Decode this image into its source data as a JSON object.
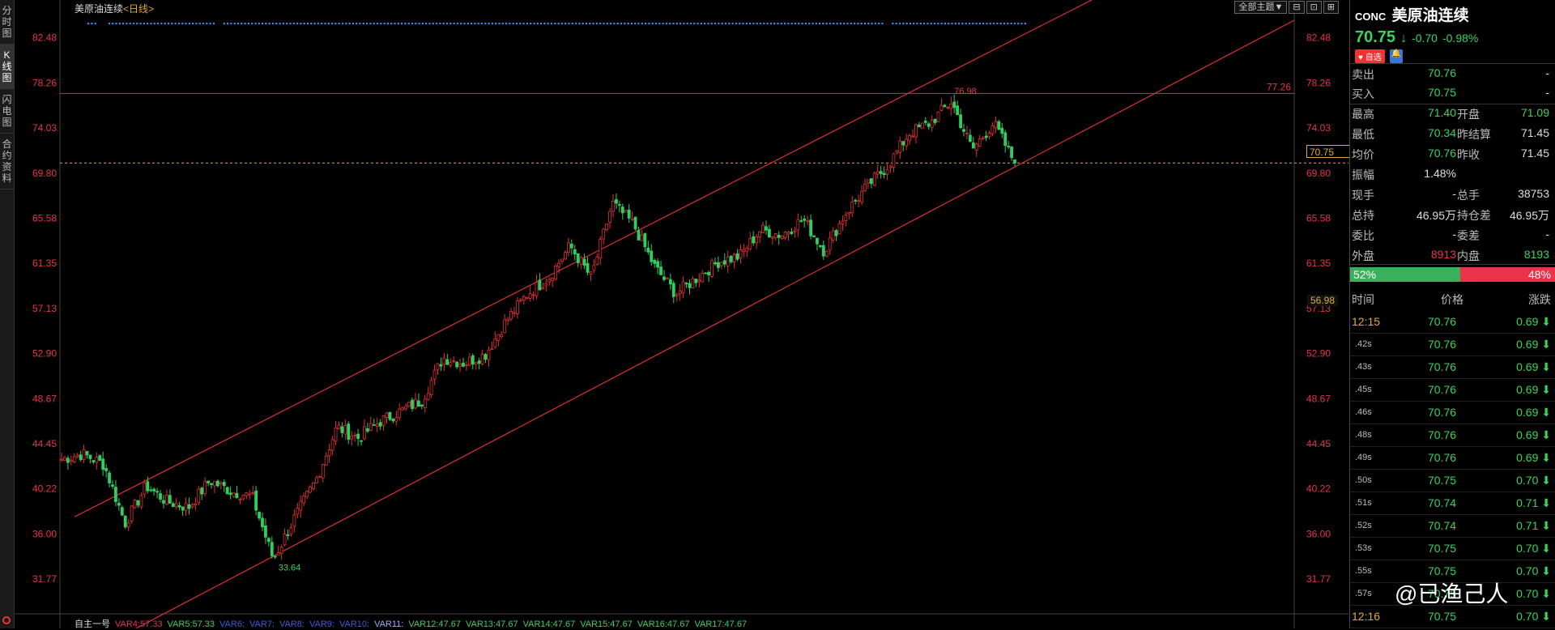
{
  "left_tabs": [
    "分时图",
    "K线图",
    "闪电图",
    "合约资料"
  ],
  "chart": {
    "title": "美原油连续",
    "period": "<日线>",
    "toolbar": [
      "全部主题▼",
      "⊟",
      "⊡",
      "⊞"
    ],
    "y_ticks": [
      "82.48",
      "78.26",
      "74.03",
      "69.80",
      "65.58",
      "61.35",
      "57.13",
      "52.90",
      "48.67",
      "44.45",
      "40.22",
      "36.00",
      "31.77"
    ],
    "resistance_label": "77.26",
    "high_label": "76.98",
    "low_label": "33.64",
    "current_price_label": "70.75",
    "mid_label": "56.98",
    "bottom_indicators": [
      {
        "text": "自主一号",
        "color": "#dddddd"
      },
      {
        "text": "VAR4:57.33",
        "color": "#e9334a"
      },
      {
        "text": "VAR5:57.33",
        "color": "#3bd25b"
      },
      {
        "text": "VAR6:",
        "color": "#3a5fd9"
      },
      {
        "text": "VAR7:",
        "color": "#3a5fd9"
      },
      {
        "text": "VAR8:",
        "color": "#3a5fd9"
      },
      {
        "text": "VAR9:",
        "color": "#3a5fd9"
      },
      {
        "text": "VAR10:",
        "color": "#3a5fd9"
      },
      {
        "text": "VAR11:",
        "color": "#a0a8ff"
      },
      {
        "text": "VAR12:47.67",
        "color": "#3bd25b"
      },
      {
        "text": "VAR13:47.67",
        "color": "#3bd25b"
      },
      {
        "text": "VAR14:47.67",
        "color": "#3bd25b"
      },
      {
        "text": "VAR15:47.67",
        "color": "#3bd25b"
      },
      {
        "text": "VAR16:47.67",
        "color": "#3bd25b"
      },
      {
        "text": "VAR17:47.67",
        "color": "#3bd25b"
      }
    ]
  },
  "chart_data": {
    "type": "candlestick",
    "y_range": [
      29.5,
      84.5
    ],
    "y_ticks": [
      82.48,
      78.26,
      74.03,
      69.8,
      65.58,
      61.35,
      57.13,
      52.9,
      48.67,
      44.45,
      40.22,
      36.0,
      31.77
    ],
    "horizontal_lines": [
      77.26,
      70.75
    ],
    "marked_high": 76.98,
    "marked_low": 33.64,
    "last_close": 70.75,
    "close_path_anchors": [
      43.0,
      43.5,
      42.5,
      37.0,
      40.5,
      39.0,
      38.5,
      41.0,
      40.0,
      39.5,
      33.6,
      37.5,
      41.0,
      46.0,
      45.0,
      46.5,
      47.5,
      48.5,
      52.5,
      52.0,
      52.8,
      56.0,
      58.5,
      60.0,
      63.0,
      60.0,
      67.0,
      65.0,
      61.0,
      58.5,
      60.0,
      61.5,
      62.0,
      64.5,
      64.0,
      65.5,
      62.5,
      66.0,
      68.5,
      70.5,
      73.5,
      74.5,
      76.5,
      72.0,
      74.5,
      70.75
    ]
  },
  "panel": {
    "code": "CONC",
    "name": "美原油连续",
    "price": "70.75",
    "arrow": "↓",
    "change": "-0.70",
    "pct": "-0.98%",
    "fav": "自选",
    "bell": "🔔",
    "rows": [
      {
        "k": "卖出",
        "v": "70.76",
        "vc": "green",
        "k2": "",
        "v2": "-",
        "v2c": "white"
      },
      {
        "k": "买入",
        "v": "70.75",
        "vc": "green",
        "k2": "",
        "v2": "-",
        "v2c": "white"
      },
      {
        "k": "最高",
        "v": "71.40",
        "vc": "green",
        "k2": "开盘",
        "v2": "71.09",
        "v2c": "green"
      },
      {
        "k": "最低",
        "v": "70.34",
        "vc": "green",
        "k2": "昨结算",
        "v2": "71.45",
        "v2c": "white"
      },
      {
        "k": "均价",
        "v": "70.76",
        "vc": "green",
        "k2": "昨收",
        "v2": "71.45",
        "v2c": "white"
      },
      {
        "k": "振幅",
        "v": "1.48%",
        "vc": "white",
        "k2": "",
        "v2": "",
        "v2c": "white"
      },
      {
        "k": "现手",
        "v": "-",
        "vc": "white",
        "k2": "总手",
        "v2": "38753",
        "v2c": "white"
      },
      {
        "k": "总持",
        "v": "46.95万",
        "vc": "white",
        "k2": "持仓差",
        "v2": "46.95万",
        "v2c": "white"
      },
      {
        "k": "委比",
        "v": "-",
        "vc": "white",
        "k2": "委差",
        "v2": "-",
        "v2c": "white"
      },
      {
        "k": "外盘",
        "v": "8913",
        "vc": "red",
        "k2": "内盘",
        "v2": "8193",
        "v2c": "green"
      }
    ],
    "buy_ratio": "52%",
    "sell_ratio": "48%",
    "buy_fraction": 0.52,
    "tick_headers": {
      "time": "时间",
      "price": "价格",
      "change": "涨跌"
    },
    "ticks": [
      {
        "t": "12:15",
        "p": "70.76",
        "c": "0.69",
        "big": true
      },
      {
        "t": ".42s",
        "p": "70.76",
        "c": "0.69"
      },
      {
        "t": ".43s",
        "p": "70.76",
        "c": "0.69"
      },
      {
        "t": ".45s",
        "p": "70.76",
        "c": "0.69"
      },
      {
        "t": ".46s",
        "p": "70.76",
        "c": "0.69"
      },
      {
        "t": ".48s",
        "p": "70.76",
        "c": "0.69"
      },
      {
        "t": ".49s",
        "p": "70.76",
        "c": "0.69"
      },
      {
        "t": ".50s",
        "p": "70.75",
        "c": "0.70"
      },
      {
        "t": ".51s",
        "p": "70.74",
        "c": "0.71"
      },
      {
        "t": ".52s",
        "p": "70.74",
        "c": "0.71"
      },
      {
        "t": ".53s",
        "p": "70.75",
        "c": "0.70"
      },
      {
        "t": ".55s",
        "p": "70.75",
        "c": "0.70"
      },
      {
        "t": ".57s",
        "p": "70.75",
        "c": "0.70"
      },
      {
        "t": "12:16",
        "p": "70.75",
        "c": "0.70",
        "big": true
      }
    ],
    "watermark": "@已渔己人"
  }
}
